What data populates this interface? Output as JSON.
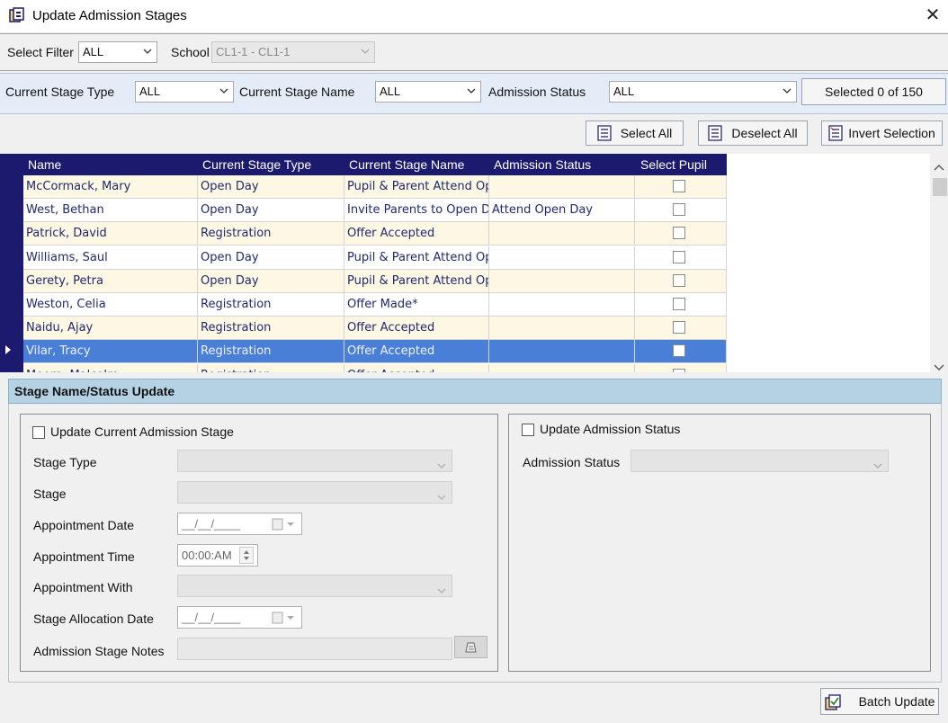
{
  "window": {
    "title": "Update Admission Stages"
  },
  "filter_bar": {
    "select_filter_label": "Select Filter",
    "select_filter_value": "ALL",
    "school_label": "School",
    "school_value": "CL1-1 - CL1-1"
  },
  "stage_bar": {
    "current_stage_type_label": "Current Stage Type",
    "current_stage_type_value": "ALL",
    "current_stage_name_label": "Current Stage Name",
    "current_stage_name_value": "ALL",
    "admission_status_label": "Admission Status",
    "admission_status_value": "ALL",
    "selected_count": "Selected 0 of 150"
  },
  "selection_buttons": {
    "select_all": "Select All",
    "deselect_all": "Deselect All",
    "invert_selection": "Invert Selection"
  },
  "grid": {
    "columns": [
      "Name",
      "Current Stage Type",
      "Current Stage Name",
      "Admission Status",
      "Select Pupil"
    ],
    "rows": [
      {
        "name": "McCormack, Mary",
        "stage_type": "Open Day",
        "stage_name": "Pupil & Parent Attend Op",
        "status": "",
        "selected": false
      },
      {
        "name": "West, Bethan",
        "stage_type": "Open Day",
        "stage_name": "Invite Parents to Open D",
        "status": "Attend Open Day",
        "selected": false
      },
      {
        "name": "Patrick, David",
        "stage_type": "Registration",
        "stage_name": "Offer Accepted",
        "status": "",
        "selected": false
      },
      {
        "name": "Williams, Saul",
        "stage_type": "Open Day",
        "stage_name": "Pupil & Parent Attend Op",
        "status": "",
        "selected": false
      },
      {
        "name": "Gerety, Petra",
        "stage_type": "Open Day",
        "stage_name": "Pupil & Parent Attend Op",
        "status": "",
        "selected": false
      },
      {
        "name": "Weston, Celia",
        "stage_type": "Registration",
        "stage_name": "Offer Made*",
        "status": "",
        "selected": false
      },
      {
        "name": "Naidu, Ajay",
        "stage_type": "Registration",
        "stage_name": "Offer Accepted",
        "status": "",
        "selected": false
      },
      {
        "name": "Vilar, Tracy",
        "stage_type": "Registration",
        "stage_name": "Offer Accepted",
        "status": "",
        "selected": false
      },
      {
        "name": "Moore, Malcolm",
        "stage_type": "Registration",
        "stage_name": "Offer Accepted",
        "status": "",
        "selected": false
      }
    ],
    "current_row": 7
  },
  "update_panel": {
    "title": "Stage Name/Status Update",
    "update_stage_label": "Update Current Admission Stage",
    "stage_type_label": "Stage Type",
    "stage_label": "Stage",
    "appointment_date_label": "Appointment Date",
    "appointment_date_value": "__/__/____",
    "appointment_time_label": "Appointment Time",
    "appointment_time_value": "00:00:AM",
    "appointment_with_label": "Appointment With",
    "stage_allocation_date_label": "Stage Allocation Date",
    "stage_allocation_date_value": "__/__/____",
    "notes_label": "Admission Stage  Notes",
    "update_status_label": "Update Admission Status",
    "admission_status_label": "Admission Status"
  },
  "footer": {
    "batch_update": "Batch Update"
  },
  "colors": {
    "grid_header": "#1c1a6e",
    "selected_row": "#4a7fd8",
    "odd_row": "#fdf7e4",
    "panel_head": "#b4d2e4"
  }
}
